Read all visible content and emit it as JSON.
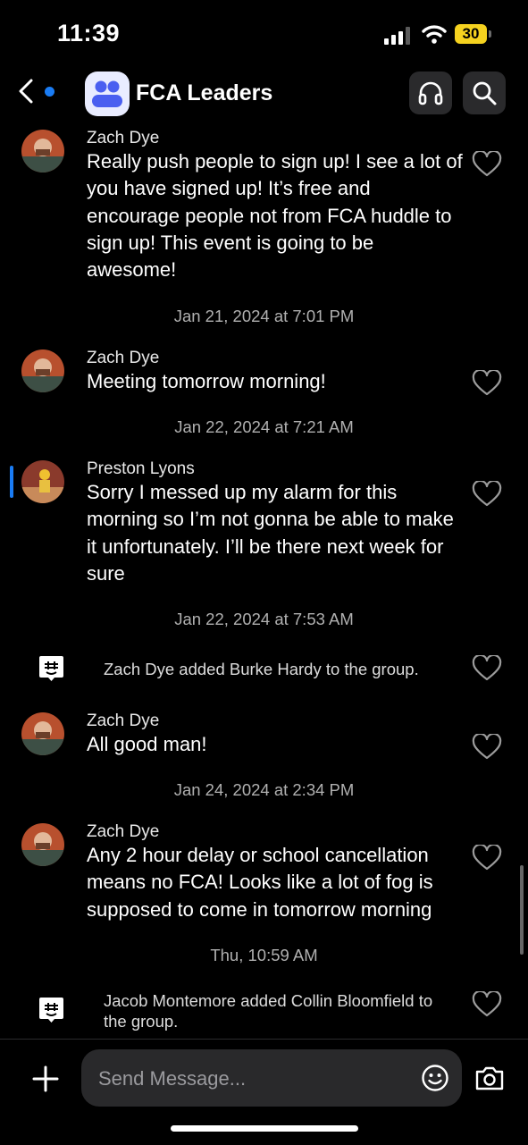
{
  "status_bar": {
    "time": "11:39",
    "battery": "30"
  },
  "header": {
    "title": "FCA Leaders",
    "icons": [
      "back-icon",
      "headphones-icon",
      "search-icon"
    ]
  },
  "messages": [
    {
      "sender": "Zach Dye",
      "text": "Really push people to sign up! I see a lot of you have signed up! It’s free and encourage people not from FCA huddle to sign up! This event is going to be awesome!"
    },
    {
      "sender": "Zach Dye",
      "text": "Meeting tomorrow morning!"
    },
    {
      "sender": "Preston Lyons",
      "text": "Sorry I messed up my alarm for this morning so I’m not gonna be able to make it unfortunately. I’ll be there next week for sure"
    },
    {
      "sender": "Zach Dye",
      "text": "All good man!"
    },
    {
      "sender": "Zach Dye",
      "text": "Any 2 hour delay or school cancellation means no FCA! Looks like a lot of fog is supposed to come in tomorrow morning"
    }
  ],
  "timestamps": [
    "Jan 21, 2024 at 7:01 PM",
    "Jan 22, 2024 at 7:21 AM",
    "Jan 22, 2024 at 7:53 AM",
    "Jan 24, 2024 at 2:34 PM",
    "Thu, 10:59 AM"
  ],
  "system_messages": [
    {
      "text": "Zach Dye added Burke Hardy to the group."
    },
    {
      "text": "Jacob Montemore added Collin Bloomfield to the group."
    }
  ],
  "composer": {
    "placeholder": "Send Message...",
    "icons": [
      "plus-icon",
      "emoji-icon",
      "camera-icon"
    ]
  },
  "colors": {
    "background": "#000000",
    "accent": "#1a7cf4",
    "battery": "#f5d21f",
    "input": "#29292b"
  }
}
